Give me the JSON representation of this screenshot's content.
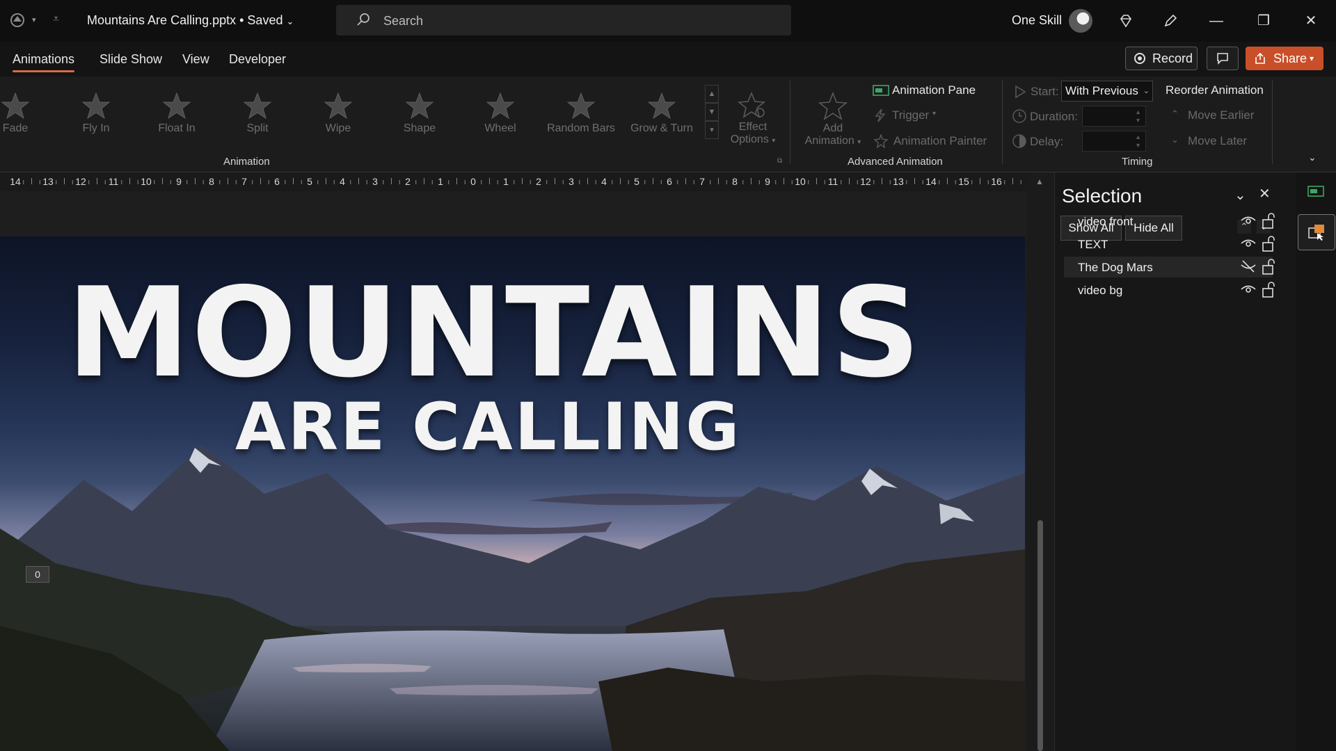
{
  "titlebar": {
    "doc_title": "Mountains Are Calling.pptx • Saved",
    "search_placeholder": "Search",
    "user_name": "One Skill"
  },
  "ribbon_tabs": [
    "Animations",
    "Slide Show",
    "View",
    "Developer"
  ],
  "actions": {
    "record": "Record",
    "share": "Share"
  },
  "animation_gallery": {
    "items": [
      "Fade",
      "Fly In",
      "Float In",
      "Split",
      "Wipe",
      "Shape",
      "Wheel",
      "Random Bars",
      "Grow & Turn"
    ],
    "effect_options": [
      "Effect",
      "Options"
    ],
    "group_label": "Animation"
  },
  "advanced_animation": {
    "add_animation": [
      "Add",
      "Animation"
    ],
    "animation_pane": "Animation Pane",
    "trigger": "Trigger",
    "animation_painter": "Animation Painter",
    "group_label": "Advanced Animation"
  },
  "timing": {
    "start_label": "Start:",
    "start_value": "With Previous",
    "duration_label": "Duration:",
    "delay_label": "Delay:",
    "reorder_label": "Reorder Animation",
    "move_earlier": "Move Earlier",
    "move_later": "Move Later",
    "group_label": "Timing"
  },
  "ruler": {
    "labels": [
      "14",
      "13",
      "12",
      "11",
      "10",
      "9",
      "8",
      "7",
      "6",
      "5",
      "4",
      "3",
      "2",
      "1",
      "0",
      "1",
      "2",
      "3",
      "4",
      "5",
      "6",
      "7",
      "8",
      "9",
      "10",
      "11",
      "12",
      "13",
      "14",
      "15",
      "16"
    ]
  },
  "slide": {
    "title": "MOUNTAINS",
    "subtitle": "ARE CALLING",
    "anim_tag": "0"
  },
  "selection_pane": {
    "title": "Selection",
    "show_all": "Show All",
    "hide_all": "Hide All",
    "items": [
      {
        "name": "video front",
        "visible": true
      },
      {
        "name": "TEXT",
        "visible": true
      },
      {
        "name": "The Dog Mars",
        "visible": false
      },
      {
        "name": "video bg",
        "visible": true
      }
    ]
  },
  "colors": {
    "accent": "#d86b4a",
    "share": "#c84f2a"
  }
}
